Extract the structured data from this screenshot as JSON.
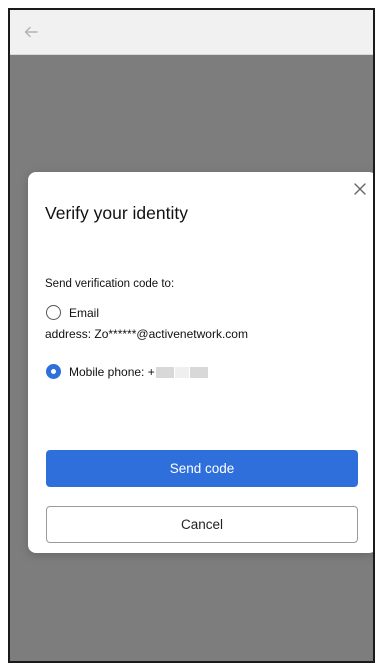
{
  "header": {
    "back_icon": "arrow-left-icon"
  },
  "dialog": {
    "title": "Verify your identity",
    "close_icon": "close-icon",
    "prompt": "Send verification code to:",
    "options": [
      {
        "label": "Email",
        "selected": false,
        "detail_label": "address:",
        "detail_value": "Zo******@activenetwork.com"
      },
      {
        "label": "Mobile phone: +",
        "selected": true
      }
    ],
    "send_label": "Send code",
    "cancel_label": "Cancel"
  },
  "colors": {
    "accent": "#2f6fdc",
    "overlay": "#7d7d7d",
    "top_bar": "#f1f1f1"
  }
}
